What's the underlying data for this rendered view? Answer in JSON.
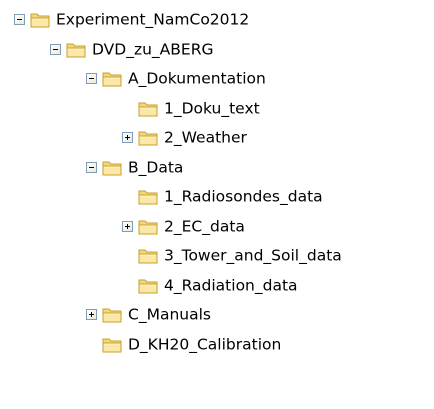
{
  "tree": {
    "icon": "folder-icon",
    "colors": {
      "folder": "#f5d77b",
      "folder_edge": "#c7a02c",
      "expander_border": "#7f9db9"
    },
    "nodes": [
      {
        "label": "Experiment_NamCo2012",
        "depth": 0,
        "expander": "minus"
      },
      {
        "label": "DVD_zu_ABERG",
        "depth": 1,
        "expander": "minus"
      },
      {
        "label": "A_Dokumentation",
        "depth": 2,
        "expander": "minus"
      },
      {
        "label": "1_Doku_text",
        "depth": 3,
        "expander": "none"
      },
      {
        "label": "2_Weather",
        "depth": 3,
        "expander": "plus"
      },
      {
        "label": "B_Data",
        "depth": 2,
        "expander": "minus"
      },
      {
        "label": "1_Radiosondes_data",
        "depth": 3,
        "expander": "none"
      },
      {
        "label": "2_EC_data",
        "depth": 3,
        "expander": "plus"
      },
      {
        "label": "3_Tower_and_Soil_data",
        "depth": 3,
        "expander": "none"
      },
      {
        "label": "4_Radiation_data",
        "depth": 3,
        "expander": "none"
      },
      {
        "label": "C_Manuals",
        "depth": 2,
        "expander": "plus"
      },
      {
        "label": "D_KH20_Calibration",
        "depth": 2,
        "expander": "none"
      }
    ]
  }
}
